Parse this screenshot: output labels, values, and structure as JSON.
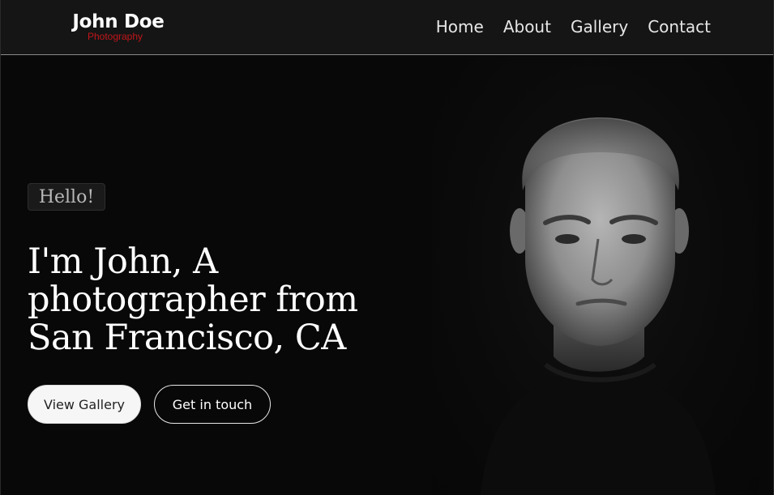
{
  "brand": {
    "name": "John Doe",
    "tagline": "Photography",
    "tagline_color": "#c0161b"
  },
  "nav": {
    "items": [
      {
        "label": "Home"
      },
      {
        "label": "About"
      },
      {
        "label": "Gallery"
      },
      {
        "label": "Contact"
      }
    ]
  },
  "hero": {
    "greeting": "Hello!",
    "title_lines": [
      "I'm John, A",
      "photographer from",
      "San Francisco, CA"
    ],
    "primary_button": "View Gallery",
    "secondary_button": "Get in touch",
    "portrait_icon": "portrait-photo"
  },
  "colors": {
    "background": "#080808",
    "header": "#151515"
  }
}
